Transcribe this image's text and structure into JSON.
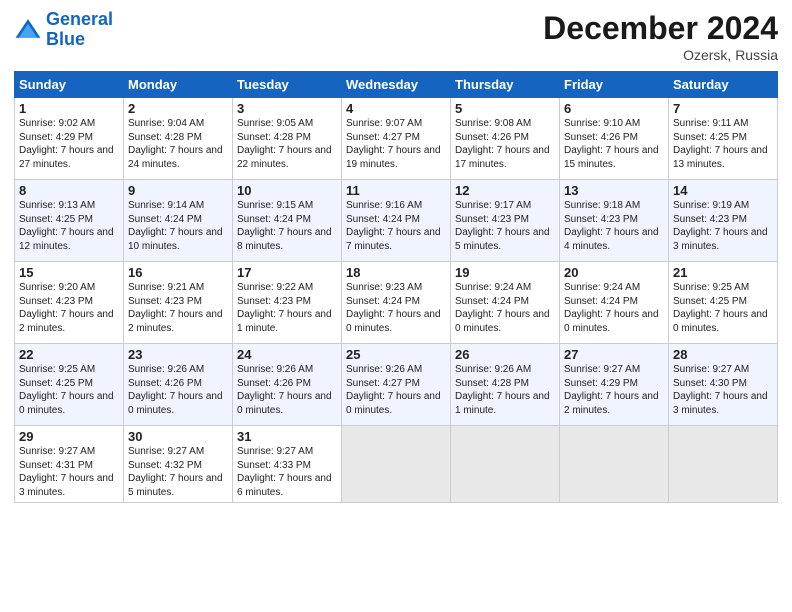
{
  "header": {
    "logo_line1": "General",
    "logo_line2": "Blue",
    "month": "December 2024",
    "location": "Ozersk, Russia"
  },
  "weekdays": [
    "Sunday",
    "Monday",
    "Tuesday",
    "Wednesday",
    "Thursday",
    "Friday",
    "Saturday"
  ],
  "weeks": [
    [
      {
        "day": "1",
        "sunrise": "9:02 AM",
        "sunset": "4:29 PM",
        "daylight": "7 hours and 27 minutes."
      },
      {
        "day": "2",
        "sunrise": "9:04 AM",
        "sunset": "4:28 PM",
        "daylight": "7 hours and 24 minutes."
      },
      {
        "day": "3",
        "sunrise": "9:05 AM",
        "sunset": "4:28 PM",
        "daylight": "7 hours and 22 minutes."
      },
      {
        "day": "4",
        "sunrise": "9:07 AM",
        "sunset": "4:27 PM",
        "daylight": "7 hours and 19 minutes."
      },
      {
        "day": "5",
        "sunrise": "9:08 AM",
        "sunset": "4:26 PM",
        "daylight": "7 hours and 17 minutes."
      },
      {
        "day": "6",
        "sunrise": "9:10 AM",
        "sunset": "4:26 PM",
        "daylight": "7 hours and 15 minutes."
      },
      {
        "day": "7",
        "sunrise": "9:11 AM",
        "sunset": "4:25 PM",
        "daylight": "7 hours and 13 minutes."
      }
    ],
    [
      {
        "day": "8",
        "sunrise": "9:13 AM",
        "sunset": "4:25 PM",
        "daylight": "7 hours and 12 minutes."
      },
      {
        "day": "9",
        "sunrise": "9:14 AM",
        "sunset": "4:24 PM",
        "daylight": "7 hours and 10 minutes."
      },
      {
        "day": "10",
        "sunrise": "9:15 AM",
        "sunset": "4:24 PM",
        "daylight": "7 hours and 8 minutes."
      },
      {
        "day": "11",
        "sunrise": "9:16 AM",
        "sunset": "4:24 PM",
        "daylight": "7 hours and 7 minutes."
      },
      {
        "day": "12",
        "sunrise": "9:17 AM",
        "sunset": "4:23 PM",
        "daylight": "7 hours and 5 minutes."
      },
      {
        "day": "13",
        "sunrise": "9:18 AM",
        "sunset": "4:23 PM",
        "daylight": "7 hours and 4 minutes."
      },
      {
        "day": "14",
        "sunrise": "9:19 AM",
        "sunset": "4:23 PM",
        "daylight": "7 hours and 3 minutes."
      }
    ],
    [
      {
        "day": "15",
        "sunrise": "9:20 AM",
        "sunset": "4:23 PM",
        "daylight": "7 hours and 2 minutes."
      },
      {
        "day": "16",
        "sunrise": "9:21 AM",
        "sunset": "4:23 PM",
        "daylight": "7 hours and 2 minutes."
      },
      {
        "day": "17",
        "sunrise": "9:22 AM",
        "sunset": "4:23 PM",
        "daylight": "7 hours and 1 minute."
      },
      {
        "day": "18",
        "sunrise": "9:23 AM",
        "sunset": "4:24 PM",
        "daylight": "7 hours and 0 minutes."
      },
      {
        "day": "19",
        "sunrise": "9:24 AM",
        "sunset": "4:24 PM",
        "daylight": "7 hours and 0 minutes."
      },
      {
        "day": "20",
        "sunrise": "9:24 AM",
        "sunset": "4:24 PM",
        "daylight": "7 hours and 0 minutes."
      },
      {
        "day": "21",
        "sunrise": "9:25 AM",
        "sunset": "4:25 PM",
        "daylight": "7 hours and 0 minutes."
      }
    ],
    [
      {
        "day": "22",
        "sunrise": "9:25 AM",
        "sunset": "4:25 PM",
        "daylight": "7 hours and 0 minutes."
      },
      {
        "day": "23",
        "sunrise": "9:26 AM",
        "sunset": "4:26 PM",
        "daylight": "7 hours and 0 minutes."
      },
      {
        "day": "24",
        "sunrise": "9:26 AM",
        "sunset": "4:26 PM",
        "daylight": "7 hours and 0 minutes."
      },
      {
        "day": "25",
        "sunrise": "9:26 AM",
        "sunset": "4:27 PM",
        "daylight": "7 hours and 0 minutes."
      },
      {
        "day": "26",
        "sunrise": "9:26 AM",
        "sunset": "4:28 PM",
        "daylight": "7 hours and 1 minute."
      },
      {
        "day": "27",
        "sunrise": "9:27 AM",
        "sunset": "4:29 PM",
        "daylight": "7 hours and 2 minutes."
      },
      {
        "day": "28",
        "sunrise": "9:27 AM",
        "sunset": "4:30 PM",
        "daylight": "7 hours and 3 minutes."
      }
    ],
    [
      {
        "day": "29",
        "sunrise": "9:27 AM",
        "sunset": "4:31 PM",
        "daylight": "7 hours and 3 minutes."
      },
      {
        "day": "30",
        "sunrise": "9:27 AM",
        "sunset": "4:32 PM",
        "daylight": "7 hours and 5 minutes."
      },
      {
        "day": "31",
        "sunrise": "9:27 AM",
        "sunset": "4:33 PM",
        "daylight": "7 hours and 6 minutes."
      },
      null,
      null,
      null,
      null
    ]
  ]
}
